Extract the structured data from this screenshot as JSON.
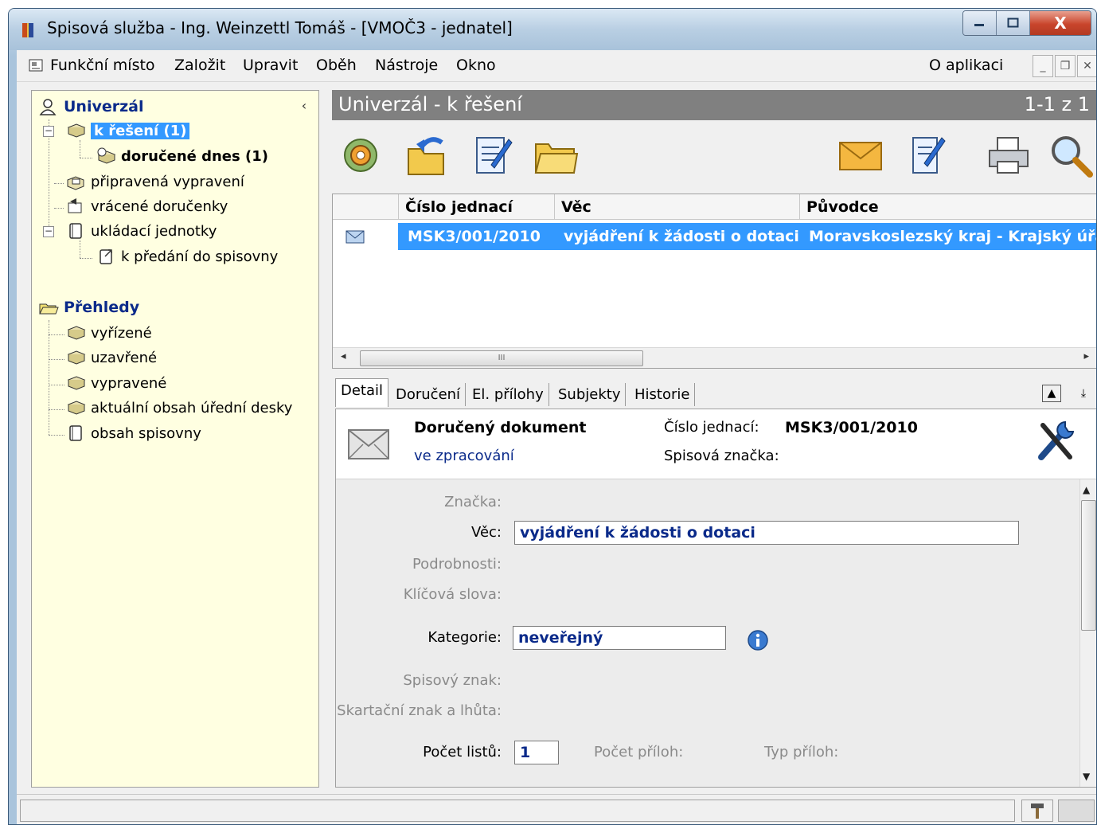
{
  "window": {
    "title": "Spisová služba - Ing. Weinzettl Tomáš - [VMOČ3 - jednatel]",
    "close_label": "X"
  },
  "menu": {
    "items": [
      {
        "label": "Funkční místo"
      },
      {
        "label": "Založit"
      },
      {
        "label": "Upravit"
      },
      {
        "label": "Oběh"
      },
      {
        "label": "Nástroje"
      },
      {
        "label": "Okno"
      }
    ],
    "about": "O aplikaci"
  },
  "tree": {
    "collapse": "‹",
    "group1": {
      "title": "Univerzál",
      "items": [
        {
          "label": "k řešení (1)",
          "selected": true
        },
        {
          "label": "doručené dnes (1)"
        },
        {
          "label": "připravená vypravení"
        },
        {
          "label": "vrácené doručenky"
        },
        {
          "label": "ukládací jednotky"
        },
        {
          "label": "k předání do spisovny"
        }
      ]
    },
    "group2": {
      "title": "Přehledy",
      "items": [
        {
          "label": "vyřízené"
        },
        {
          "label": "uzavřené"
        },
        {
          "label": "vypravené"
        },
        {
          "label": "aktuální obsah úřední desky"
        },
        {
          "label": "obsah spisovny"
        }
      ]
    }
  },
  "header": {
    "title": "Univerzál - k řešení",
    "count": "1-1 z 1"
  },
  "toolbar": {
    "left": [
      "gear-icon",
      "return-icon",
      "edit-document-icon",
      "folder-icon"
    ],
    "right": [
      "envelope-icon",
      "note-icon",
      "printer-icon",
      "search-icon"
    ]
  },
  "grid": {
    "columns": [
      "Číslo jednací",
      "Věc",
      "Původce"
    ],
    "rows": [
      {
        "cislo": "MSK3/001/2010",
        "vec": "vyjádření k žádosti o dotaci",
        "puvodce": "Moravskoslezský kraj - Krajský úřad"
      }
    ],
    "scroll_grip": "III"
  },
  "tabs": [
    "Detail",
    "Doručení",
    "El. přílohy",
    "Subjekty",
    "Historie"
  ],
  "detail": {
    "doc_type": "Doručený dokument",
    "state": "ve zpracování",
    "cislo_label": "Číslo jednací:",
    "cislo_value": "MSK3/001/2010",
    "znacka_label": "Spisová značka:",
    "fields": {
      "znacka_label": "Značka:",
      "vec_label": "Věc:",
      "vec_value": "vyjádření k žádosti o dotaci",
      "podrobnosti_label": "Podrobnosti:",
      "klicova_label": "Klíčová slova:",
      "kategorie_label": "Kategorie:",
      "kategorie_value": "neveřejný",
      "spisovy_znak_label": "Spisový znak:",
      "skartacni_label": "Skartační znak a lhůta:",
      "pocet_listu_label": "Počet listů:",
      "pocet_listu_value": "1",
      "pocet_priloh_label": "Počet příloh:",
      "typ_priloh_label": "Typ příloh:"
    }
  },
  "colors": {
    "selection": "#3399ff",
    "tree_bg": "#ffffe1",
    "header_strip": "#808080",
    "field_text": "#0a2a8a"
  }
}
